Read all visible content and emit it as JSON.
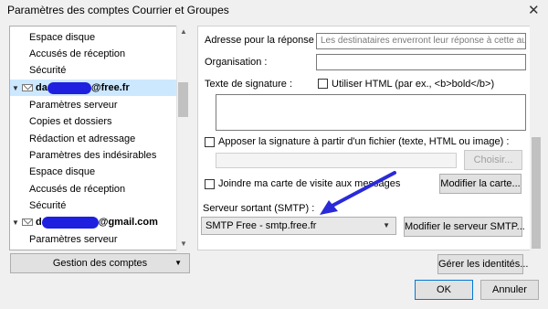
{
  "window": {
    "title": "Paramètres des comptes Courrier et Groupes",
    "close_icon": "close-icon"
  },
  "tree": {
    "items": [
      {
        "label": "Espace disque",
        "type": "child"
      },
      {
        "label": "Accusés de réception",
        "type": "child"
      },
      {
        "label": "Sécurité",
        "type": "child"
      },
      {
        "prefix": "da",
        "suffix": "@free.fr",
        "type": "account",
        "selected": true
      },
      {
        "label": "Paramètres serveur",
        "type": "child"
      },
      {
        "label": "Copies et dossiers",
        "type": "child"
      },
      {
        "label": "Rédaction et adressage",
        "type": "child"
      },
      {
        "label": "Paramètres des indésirables",
        "type": "child"
      },
      {
        "label": "Espace disque",
        "type": "child"
      },
      {
        "label": "Accusés de réception",
        "type": "child"
      },
      {
        "label": "Sécurité",
        "type": "child"
      },
      {
        "prefix": "d",
        "suffix": "@gmail.com",
        "type": "account"
      },
      {
        "label": "Paramètres serveur",
        "type": "child"
      }
    ]
  },
  "buttons": {
    "manage_accounts": "Gestion des comptes",
    "manage_identities": "Gérer les identités...",
    "choose": "Choisir...",
    "edit_card": "Modifier la carte...",
    "edit_smtp": "Modifier le serveur SMTP...",
    "ok": "OK",
    "cancel": "Annuler"
  },
  "form": {
    "reply_to_label": "Adresse pour la réponse :",
    "reply_to_placeholder": "Les destinataires enverront leur réponse à cette aut",
    "organization_label": "Organisation :",
    "organization_value": "",
    "signature_label": "Texte de signature :",
    "use_html_label": "Utiliser HTML (par ex., <b>bold</b>)",
    "attach_signature_label": "Apposer la signature à partir d'un fichier (texte, HTML ou image) :",
    "attach_vcard_label": "Joindre ma carte de visite aux messages",
    "smtp_label": "Serveur sortant (SMTP) :",
    "smtp_selected": "SMTP Free - smtp.free.fr"
  },
  "colors": {
    "selection": "#cce8ff",
    "redaction": "#1f1fe0",
    "annotation_arrow": "#2a2ad8"
  }
}
